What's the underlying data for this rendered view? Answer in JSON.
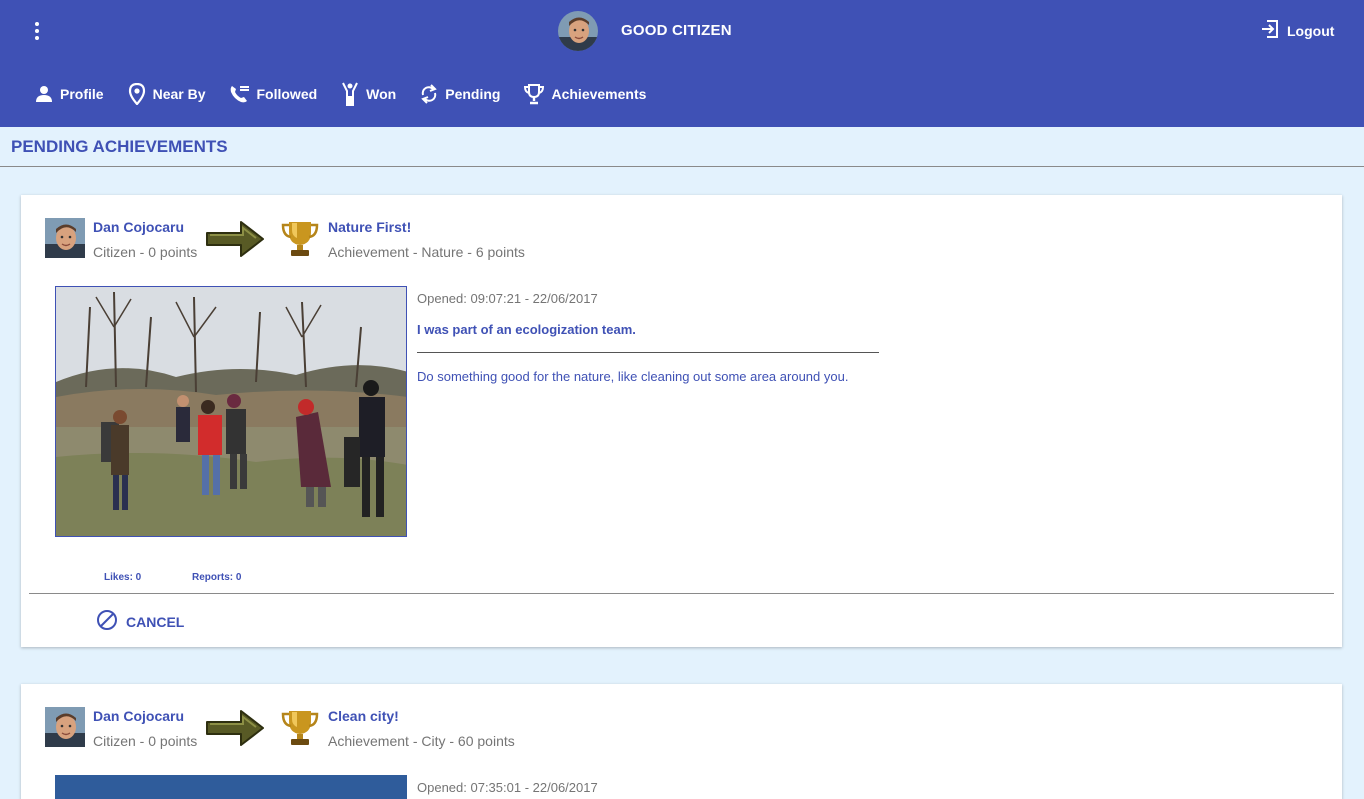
{
  "header": {
    "title": "GOOD CITIZEN",
    "logout_label": "Logout"
  },
  "nav": {
    "items": [
      {
        "label": "Profile",
        "icon": "person-icon"
      },
      {
        "label": "Near By",
        "icon": "location-pin-icon"
      },
      {
        "label": "Followed",
        "icon": "phone-follow-icon"
      },
      {
        "label": "Won",
        "icon": "winner-figure-icon"
      },
      {
        "label": "Pending",
        "icon": "sync-icon"
      },
      {
        "label": "Achievements",
        "icon": "trophy-icon"
      }
    ]
  },
  "page": {
    "section_title": "PENDING ACHIEVEMENTS"
  },
  "cards": [
    {
      "user_name": "Dan Cojocaru",
      "user_sub": "Citizen - 0 points",
      "achievement_name": "Nature First!",
      "achievement_sub": "Achievement - Nature - 6 points",
      "opened": "Opened: 09:07:21 - 22/06/2017",
      "report_title": "I was part of an ecologization team.",
      "description": "Do something good for the nature, like cleaning out some area around you.",
      "likes": "Likes: 0",
      "reports": "Reports: 0",
      "cancel_label": "CANCEL"
    },
    {
      "user_name": "Dan Cojocaru",
      "user_sub": "Citizen - 0 points",
      "achievement_name": "Clean city!",
      "achievement_sub": "Achievement - City - 60 points",
      "opened": "Opened: 07:35:01 - 22/06/2017"
    }
  ],
  "colors": {
    "primary": "#3f51b5",
    "background": "#e3f2fd",
    "muted_text": "#757575"
  }
}
